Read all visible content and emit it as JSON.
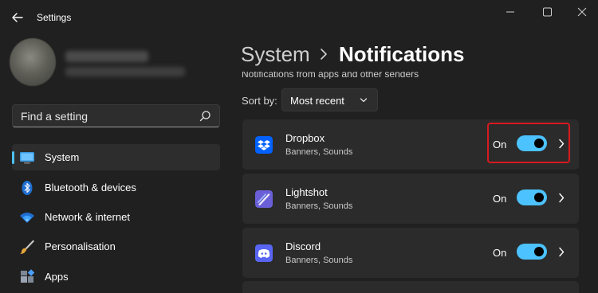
{
  "window": {
    "title": "Settings"
  },
  "search": {
    "placeholder": "Find a setting"
  },
  "sidebar": {
    "items": [
      {
        "label": "System",
        "icon": "system-icon",
        "active": true
      },
      {
        "label": "Bluetooth & devices",
        "icon": "bluetooth-icon"
      },
      {
        "label": "Network & internet",
        "icon": "wifi-icon"
      },
      {
        "label": "Personalisation",
        "icon": "brush-icon"
      },
      {
        "label": "Apps",
        "icon": "apps-icon"
      }
    ]
  },
  "breadcrumb": {
    "root": "System",
    "current": "Notifications"
  },
  "notifications": {
    "section_heading": "Notifications from apps and other senders",
    "sort_label": "Sort by:",
    "sort_value": "Most recent",
    "apps": [
      {
        "name": "Dropbox",
        "subtitle": "Banners, Sounds",
        "state": "On",
        "enabled": true,
        "icon": "dropbox-icon",
        "icon_color": "#0061fe"
      },
      {
        "name": "Lightshot",
        "subtitle": "Banners, Sounds",
        "state": "On",
        "enabled": true,
        "icon": "lightshot-icon",
        "icon_color": "#6b5fd8"
      },
      {
        "name": "Discord",
        "subtitle": "Banners, Sounds",
        "state": "On",
        "enabled": true,
        "icon": "discord-icon",
        "icon_color": "#5865f2"
      }
    ]
  },
  "colors": {
    "accent": "#4cc2ff",
    "highlight": "#d71920",
    "background": "#202020",
    "card": "#2b2b2b"
  }
}
